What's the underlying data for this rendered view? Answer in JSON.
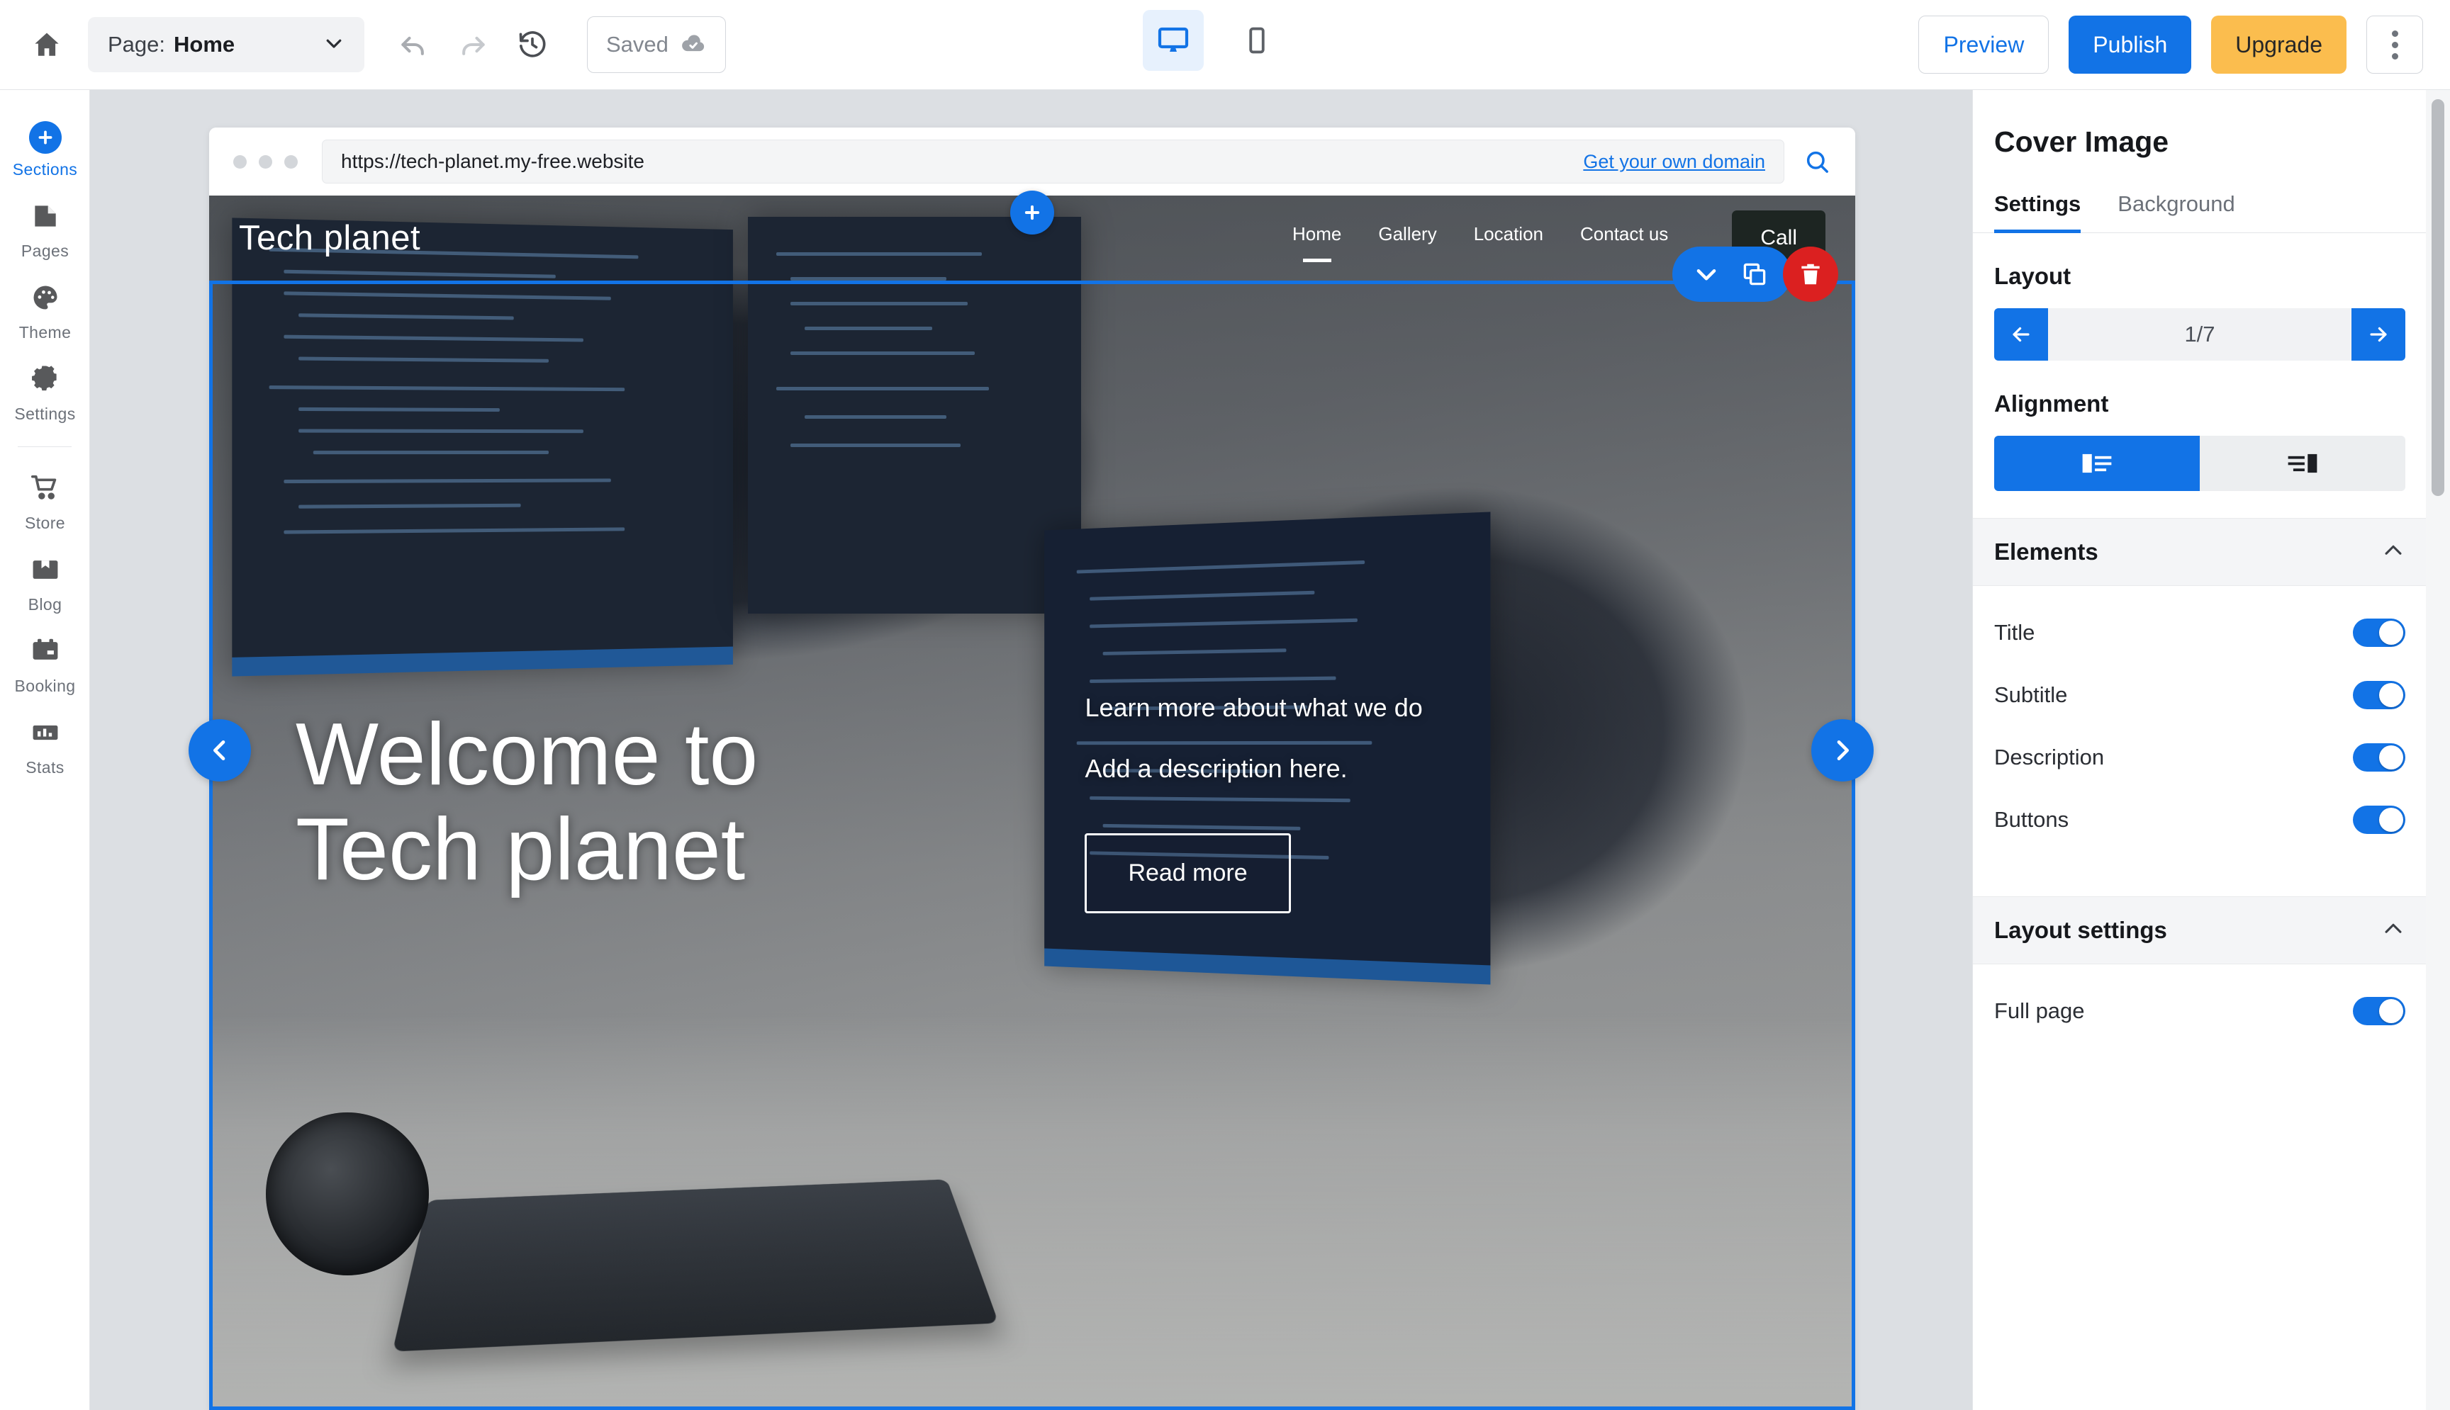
{
  "topbar": {
    "home_icon": "home-icon",
    "page_label": "Page:",
    "page_value": "Home",
    "undo_icon": "undo-icon",
    "redo_icon": "redo-icon",
    "history_icon": "history-clock-icon",
    "saved_label": "Saved",
    "saved_icon": "saved-check-cloud-icon",
    "device_desktop": "desktop-icon",
    "device_mobile": "mobile-icon",
    "device_active": "desktop",
    "preview_label": "Preview",
    "publish_label": "Publish",
    "upgrade_label": "Upgrade",
    "kebab_icon": "more-vertical-icon"
  },
  "sidebar": {
    "items": [
      {
        "label": "Sections",
        "icon": "plus-circle-icon",
        "active": true
      },
      {
        "label": "Pages",
        "icon": "page-icon",
        "active": false
      },
      {
        "label": "Theme",
        "icon": "palette-icon",
        "active": false
      },
      {
        "label": "Settings",
        "icon": "gear-icon",
        "active": false
      },
      {
        "label": "Store",
        "icon": "shopping-cart-icon",
        "active": false
      },
      {
        "label": "Blog",
        "icon": "blog-image-icon",
        "active": false
      },
      {
        "label": "Booking",
        "icon": "calendar-icon",
        "active": false
      },
      {
        "label": "Stats",
        "icon": "bar-chart-icon",
        "active": false
      }
    ]
  },
  "browser": {
    "url": "https://tech-planet.my-free.website",
    "domain_link": "Get your own domain",
    "search_icon": "search-icon"
  },
  "site": {
    "brand": "Tech planet",
    "nav": [
      {
        "label": "Home",
        "current": true
      },
      {
        "label": "Gallery",
        "current": false
      },
      {
        "label": "Location",
        "current": false
      },
      {
        "label": "Contact us",
        "current": false
      }
    ],
    "call_label": "Call",
    "hero_title_line1": "Welcome to",
    "hero_title_line2": "Tech planet",
    "hero_subtitle": "Learn more about what we do",
    "hero_description": "Add a description here.",
    "hero_button": "Read more"
  },
  "editor_overlay": {
    "add_section_icon": "plus-icon",
    "collapse_icon": "chevron-down-icon",
    "duplicate_icon": "duplicate-copy-icon",
    "delete_icon": "trash-icon",
    "prev_icon": "chevron-left-icon",
    "next_icon": "chevron-right-icon"
  },
  "panel": {
    "title": "Cover Image",
    "tabs": [
      {
        "label": "Settings",
        "active": true
      },
      {
        "label": "Background",
        "active": false
      }
    ],
    "layout_label": "Layout",
    "layout_value": "1/7",
    "layout_prev_icon": "arrow-left-icon",
    "layout_next_icon": "arrow-right-icon",
    "alignment_label": "Alignment",
    "alignment_options": [
      {
        "icon": "align-image-left-icon",
        "active": true
      },
      {
        "icon": "align-image-right-icon",
        "active": false
      }
    ],
    "elements_label": "Elements",
    "elements": [
      {
        "label": "Title",
        "on": true
      },
      {
        "label": "Subtitle",
        "on": true
      },
      {
        "label": "Description",
        "on": true
      },
      {
        "label": "Buttons",
        "on": true
      }
    ],
    "layout_settings_label": "Layout settings",
    "layout_settings": [
      {
        "label": "Full page",
        "on": true
      }
    ],
    "chevron_icon": "chevron-up-icon"
  },
  "colors": {
    "accent": "#1273e6",
    "upgrade": "#fbbd4e",
    "danger": "#db2020",
    "canvas": "#dcdfe3"
  }
}
